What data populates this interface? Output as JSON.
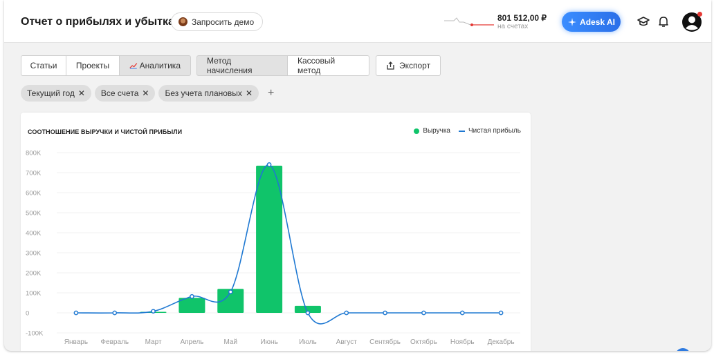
{
  "header": {
    "title": "Отчет о прибылях и убытках",
    "demo_label": "Запросить демо",
    "balance_value": "801 512,00 ₽",
    "balance_caption": "на счетах",
    "ai_label": "Adesk AI",
    "icons": [
      "graduation-cap-icon",
      "bell-icon",
      "user-avatar-icon"
    ],
    "notification_color": "#e53935"
  },
  "view_tabs": [
    {
      "label": "Статьи",
      "active": false
    },
    {
      "label": "Проекты",
      "active": false
    },
    {
      "label": "Аналитика",
      "active": true
    }
  ],
  "method_tabs": [
    {
      "label": "Метод начисления",
      "active": true
    },
    {
      "label": "Кассовый метод",
      "active": false
    }
  ],
  "export_label": "Экспорт",
  "filters": [
    {
      "label": "Текущий год"
    },
    {
      "label": "Все счета"
    },
    {
      "label": "Без учета плановых"
    }
  ],
  "add_filter_label": "+",
  "colors": {
    "revenue": "#10c46a",
    "profit": "#1e78d2",
    "ai_button": "#3a8dff"
  },
  "chart_data": {
    "type": "bar",
    "title": "СООТНОШЕНИЕ ВЫРУЧКИ И ЧИСТОЙ ПРИБЫЛИ",
    "categories": [
      "Январь",
      "Февраль",
      "Март",
      "Апрель",
      "Май",
      "Июнь",
      "Июль",
      "Август",
      "Сентябрь",
      "Октябрь",
      "Ноябрь",
      "Декабрь"
    ],
    "series": [
      {
        "name": "Выручка",
        "type": "bar",
        "values": [
          0,
          0,
          5000,
          75000,
          120000,
          735000,
          35000,
          0,
          0,
          0,
          0,
          0
        ]
      },
      {
        "name": "Чистая прибыль",
        "type": "line",
        "values": [
          0,
          0,
          8000,
          82000,
          105000,
          740000,
          0,
          0,
          0,
          0,
          0,
          0
        ]
      }
    ],
    "yticks": [
      "800K",
      "700K",
      "600K",
      "500K",
      "400K",
      "300K",
      "200K",
      "100K",
      "0",
      "-100K"
    ],
    "ylim": [
      -100000,
      800000
    ],
    "grid": true,
    "legend": "top-right"
  }
}
